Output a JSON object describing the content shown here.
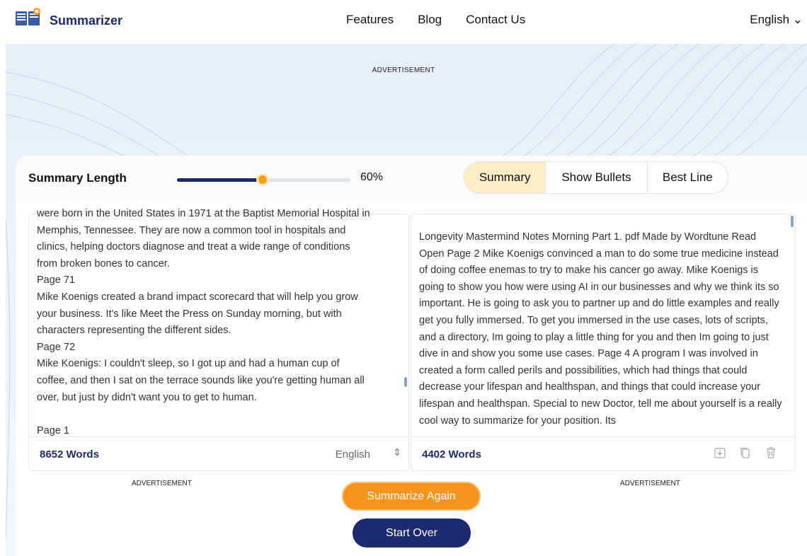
{
  "header": {
    "logo_text": "Summarizer",
    "nav": [
      "Features",
      "Blog",
      "Contact Us"
    ],
    "language": "English"
  },
  "ads": {
    "top": "ADVERTISEMENT",
    "left": "ADVERTISEMENT",
    "right": "ADVERTISEMENT"
  },
  "controls": {
    "summary_length_label": "Summary Length",
    "slider_value_percent": 60,
    "slider_label": "60%",
    "tabs": [
      "Summary",
      "Show Bullets",
      "Best Line"
    ],
    "active_tab": "Summary"
  },
  "input_panel": {
    "lines": [
      "were born in the United States in 1971 at the Baptist Memorial Hospital in",
      "Memphis, Tennessee. They are now a common tool in hospitals and",
      "clinics, helping doctors diagnose and treat a wide range of conditions",
      "from broken bones to cancer.",
      "Page 71",
      "Mike Koenigs created a brand impact scorecard that will help you grow",
      "your business. It's like Meet the Press on Sunday morning, but with",
      "characters representing the different sides.",
      "Page 72",
      "Mike Koenigs: I couldn't sleep, so I got up and had a human cup of",
      "coffee, and then I sat on the terrace sounds like you're getting human all",
      "over, but just by didn't want you to get to human.",
      "",
      "Page 1"
    ],
    "word_count": "8652 Words",
    "language": "English"
  },
  "output_panel": {
    "text": "Longevity Mastermind Notes Morning Part 1. pdf Made by Wordtune Read Open Page 2 Mike Koenigs convinced a man to do some true medicine instead of doing coffee enemas to try to make his cancer go away. Mike Koenigs is going to show you how were using AI in our businesses and why we think its so important. He is going to ask you to partner up and do little examples and really get you fully immersed. To get you immersed in the use cases, lots of scripts, and a directory, Im going to play a little thing for you and then Im going to just dive in and show you some use cases. Page 4 A program I was involved in created a form called perils and possibilities, which had things that could decrease your lifespan and healthspan, and things that could increase your lifespan and healthspan. Special to new Doctor, tell me about yourself is a really cool way to summarize for your position. Its",
    "word_count": "4402 Words",
    "icons": [
      "download-icon",
      "copy-icon",
      "trash-icon"
    ]
  },
  "buttons": {
    "summarize_again": "Summarize Again",
    "start_over": "Start Over"
  },
  "colors": {
    "brand_navy": "#1e2a6e",
    "accent_orange": "#f7941d",
    "active_tab_bg": "#fdecc8"
  }
}
